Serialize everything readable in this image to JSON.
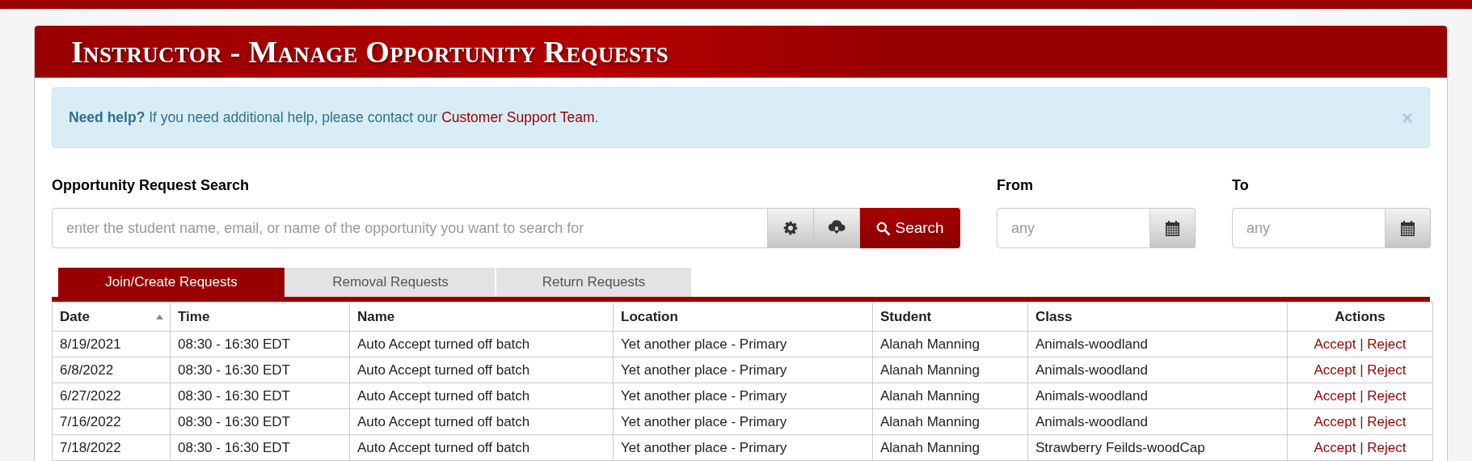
{
  "panel": {
    "title": "Instructor - Manage Opportunity Requests"
  },
  "alert": {
    "lead": "Need help?",
    "text": "If you need additional help, please contact our",
    "link": "Customer Support Team",
    "end": ".",
    "close": "×"
  },
  "search": {
    "label": "Opportunity Request Search",
    "placeholder": "enter the student name, email, or name of the opportunity you want to search for",
    "button": "Search"
  },
  "dates": [
    {
      "label": "From",
      "placeholder": "any"
    },
    {
      "label": "To",
      "placeholder": "any"
    }
  ],
  "tabs": [
    {
      "label": "Join/Create Requests",
      "selected": true
    },
    {
      "label": "Removal Requests",
      "selected": false
    },
    {
      "label": "Return Requests",
      "selected": false
    }
  ],
  "table": {
    "columns": [
      {
        "label": "Date",
        "sorted": true
      },
      {
        "label": "Time",
        "sorted": false
      },
      {
        "label": "Name",
        "sorted": false
      },
      {
        "label": "Location",
        "sorted": false
      },
      {
        "label": "Student",
        "sorted": false
      },
      {
        "label": "Class",
        "sorted": false
      },
      {
        "label": "Actions",
        "sorted": false
      }
    ],
    "rows": [
      {
        "cells": [
          "8/19/2021",
          "08:30 - 16:30 EDT",
          "Auto Accept turned off batch",
          "Yet another place - Primary",
          "Alanah Manning",
          "Animals-woodland"
        ],
        "actions": [
          "Accept",
          "|",
          "Reject"
        ]
      },
      {
        "cells": [
          "6/8/2022",
          "08:30 - 16:30 EDT",
          "Auto Accept turned off batch",
          "Yet another place - Primary",
          "Alanah Manning",
          "Animals-woodland"
        ],
        "actions": [
          "Accept",
          "|",
          "Reject"
        ]
      },
      {
        "cells": [
          "6/27/2022",
          "08:30 - 16:30 EDT",
          "Auto Accept turned off batch",
          "Yet another place - Primary",
          "Alanah Manning",
          "Animals-woodland"
        ],
        "actions": [
          "Accept",
          "|",
          "Reject"
        ]
      },
      {
        "cells": [
          "7/16/2022",
          "08:30 - 16:30 EDT",
          "Auto Accept turned off batch",
          "Yet another place - Primary",
          "Alanah Manning",
          "Animals-woodland"
        ],
        "actions": [
          "Accept",
          "|",
          "Reject"
        ]
      },
      {
        "cells": [
          "7/18/2022",
          "08:30 - 16:30 EDT",
          "Auto Accept turned off batch",
          "Yet another place - Primary",
          "Alanah Manning",
          "Strawberry Feilds-woodCap"
        ],
        "actions": [
          "Accept",
          "|",
          "Reject"
        ]
      }
    ]
  }
}
